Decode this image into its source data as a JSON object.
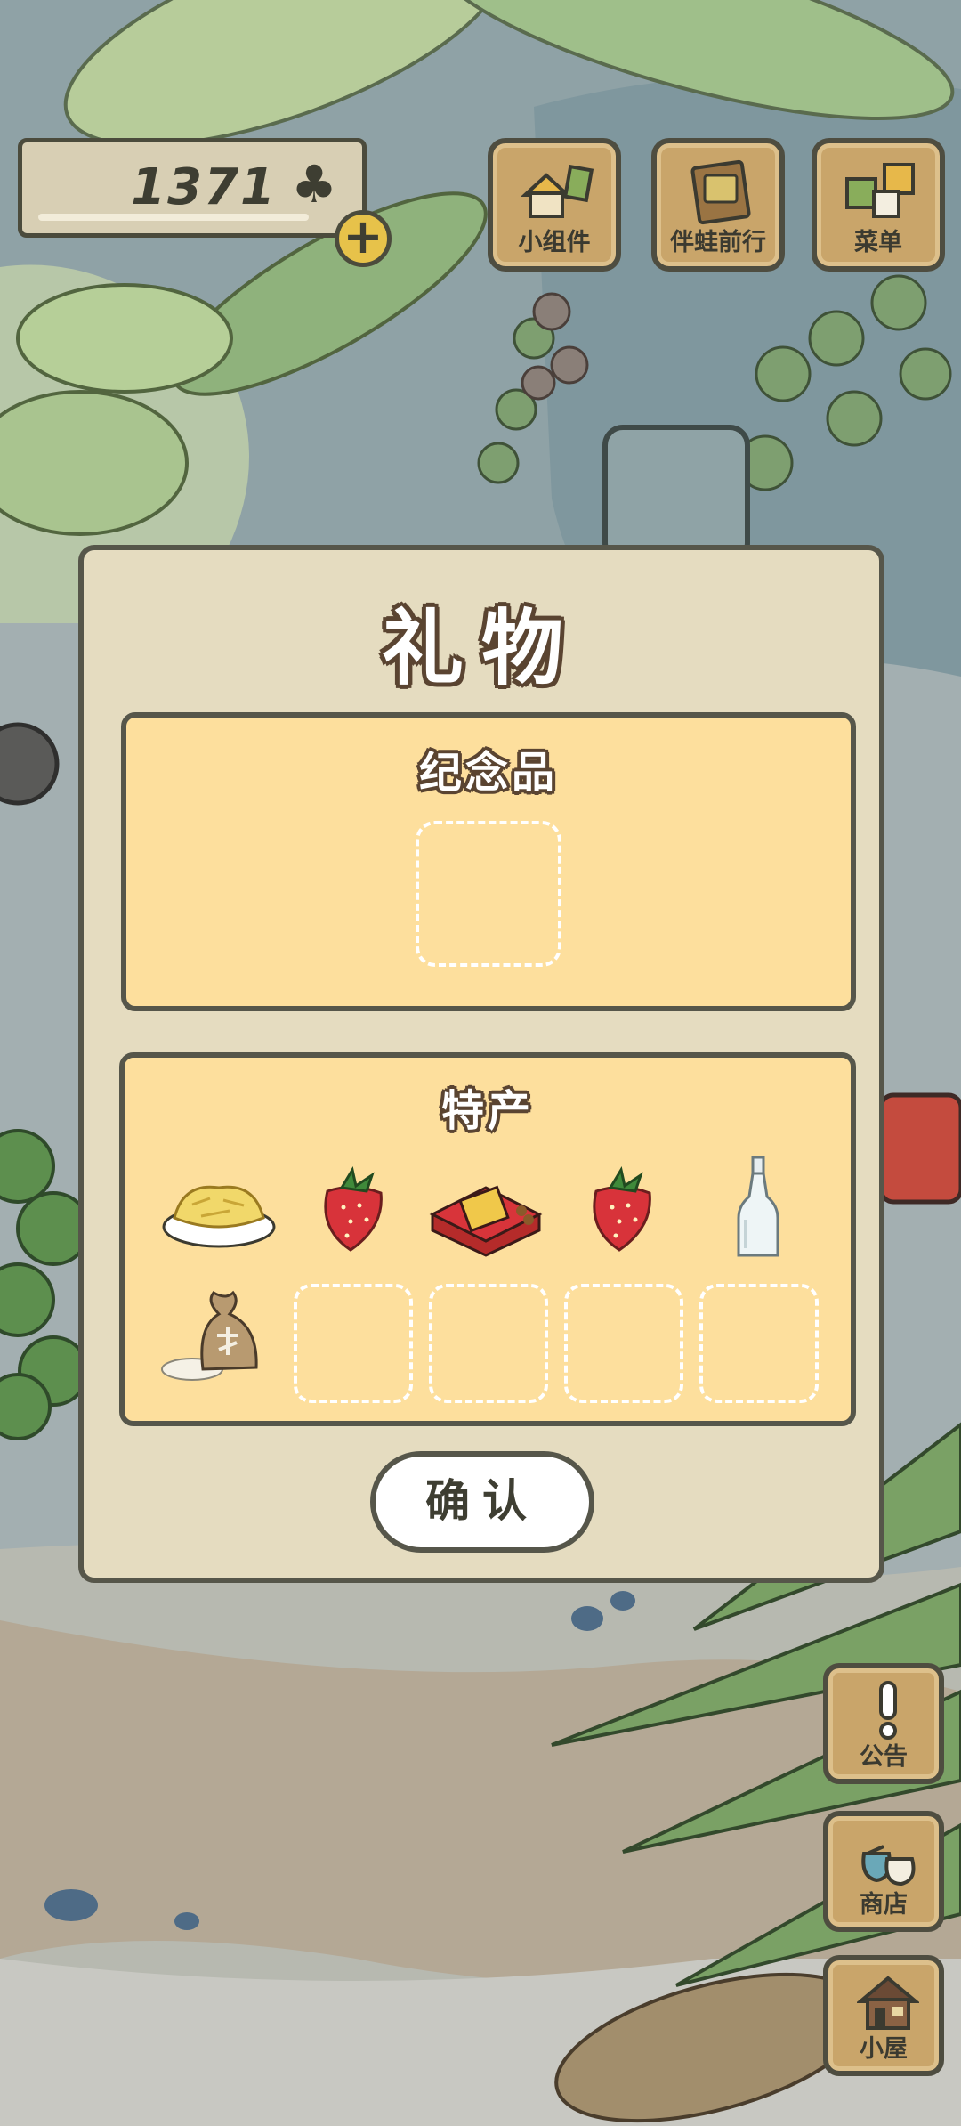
{
  "hud": {
    "clover_count": "1371",
    "clover_symbol": "♣",
    "add_symbol": "+"
  },
  "top_buttons": [
    {
      "label": "小组件",
      "icon": "widget-icon"
    },
    {
      "label": "伴蛙前行",
      "icon": "album-icon"
    },
    {
      "label": "菜单",
      "icon": "menu-icon"
    }
  ],
  "side_buttons": [
    {
      "label": "公告",
      "icon": "exclamation-icon"
    },
    {
      "label": "商店",
      "icon": "bags-icon"
    },
    {
      "label": "小屋",
      "icon": "house-icon"
    }
  ],
  "dialog": {
    "title": "礼物",
    "souvenir_section": {
      "title": "纪念品",
      "slots": [
        "empty"
      ]
    },
    "specialty_section": {
      "title": "特产",
      "items": [
        "crispy-flakes-plate-icon",
        "strawberry-icon",
        "gift-box-icon",
        "strawberry-icon",
        "glass-bottle-icon",
        "rice-bag-icon",
        "empty",
        "empty",
        "empty",
        "empty"
      ]
    },
    "confirm_label": "确认"
  },
  "colors": {
    "dialog_bg": "#e5dcc0",
    "panel_bg": "#fddf9d",
    "outline": "#56564a",
    "button_wood": "#c9a56a",
    "coin_yellow": "#e7c24a"
  }
}
